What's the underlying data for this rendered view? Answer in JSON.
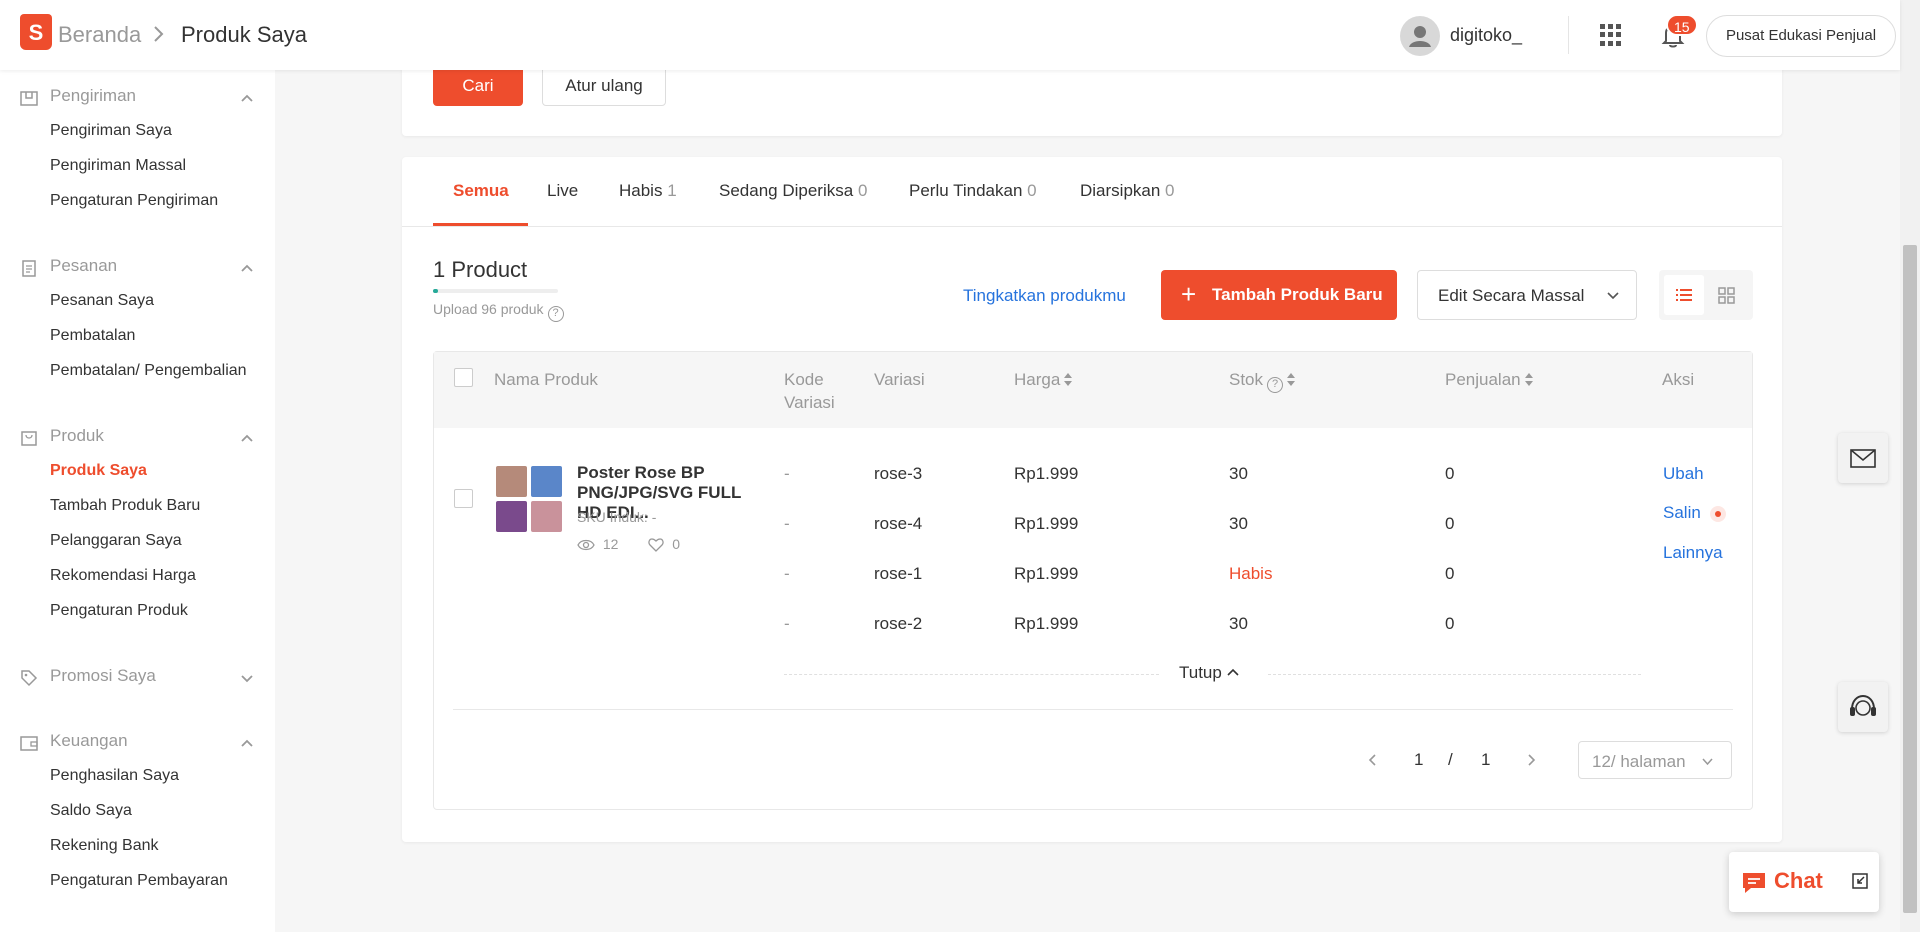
{
  "header": {
    "breadcrumb_home": "Beranda",
    "breadcrumb_current": "Produk Saya",
    "username": "digitoko_",
    "notification_count": "15",
    "edu_center": "Pusat Edukasi Penjual"
  },
  "sidebar": {
    "shipping": {
      "title": "Pengiriman",
      "items": [
        "Pengiriman Saya",
        "Pengiriman Massal",
        "Pengaturan Pengiriman"
      ]
    },
    "orders": {
      "title": "Pesanan",
      "items": [
        "Pesanan Saya",
        "Pembatalan",
        "Pembatalan/ Pengembalian"
      ]
    },
    "products": {
      "title": "Produk",
      "items": [
        "Produk Saya",
        "Tambah Produk Baru",
        "Pelanggaran Saya",
        "Rekomendasi Harga",
        "Pengaturan Produk"
      ]
    },
    "promotions": {
      "title": "Promosi Saya"
    },
    "finance": {
      "title": "Keuangan",
      "items": [
        "Penghasilan Saya",
        "Saldo Saya",
        "Rekening Bank",
        "Pengaturan Pembayaran"
      ]
    }
  },
  "search": {
    "search_label": "Cari",
    "reset_label": "Atur ulang"
  },
  "tabs": [
    {
      "label": "Semua",
      "count": ""
    },
    {
      "label": "Live",
      "count": ""
    },
    {
      "label": "Habis",
      "count": "1"
    },
    {
      "label": "Sedang Diperiksa",
      "count": "0"
    },
    {
      "label": "Perlu Tindakan",
      "count": "0"
    },
    {
      "label": "Diarsipkan",
      "count": "0"
    }
  ],
  "summary": {
    "product_count": "1 Product",
    "upload_quota": "Upload 96 produk",
    "upload_fraction": 0.04,
    "upgrade_link": "Tingkatkan produkmu",
    "add_button": "Tambah Produk Baru",
    "mass_edit": "Edit Secara Massal"
  },
  "table": {
    "headers": {
      "name": "Nama Produk",
      "code_1": "Kode",
      "code_2": "Variasi",
      "variation": "Variasi",
      "price": "Harga",
      "stock": "Stok",
      "sales": "Penjualan",
      "action": "Aksi"
    },
    "product": {
      "name": "Poster Rose BP PNG/JPG/SVG FULL HD EDI...",
      "sku": "SKU Induk: -",
      "views": "12",
      "likes": "0",
      "thumb_colors": [
        "#b58a7a",
        "#5a86c9",
        "#7a4a8c",
        "#c9929b"
      ]
    },
    "rows": [
      {
        "code": "-",
        "variation": "rose-3",
        "price": "Rp1.999",
        "stock": "30",
        "sales": "0"
      },
      {
        "code": "-",
        "variation": "rose-4",
        "price": "Rp1.999",
        "stock": "30",
        "sales": "0"
      },
      {
        "code": "-",
        "variation": "rose-1",
        "price": "Rp1.999",
        "stock": "Habis",
        "sales": "0"
      },
      {
        "code": "-",
        "variation": "rose-2",
        "price": "Rp1.999",
        "stock": "30",
        "sales": "0"
      }
    ],
    "actions": [
      "Ubah",
      "Salin",
      "Lainnya"
    ],
    "collapse_label": "Tutup"
  },
  "pagination": {
    "current": "1",
    "separator": "/",
    "total": "1",
    "page_size": "12/ halaman"
  },
  "chat": {
    "label": "Chat"
  },
  "colors": {
    "accent": "#ee4d2d",
    "link": "#2673dd",
    "success": "#26aa99"
  }
}
